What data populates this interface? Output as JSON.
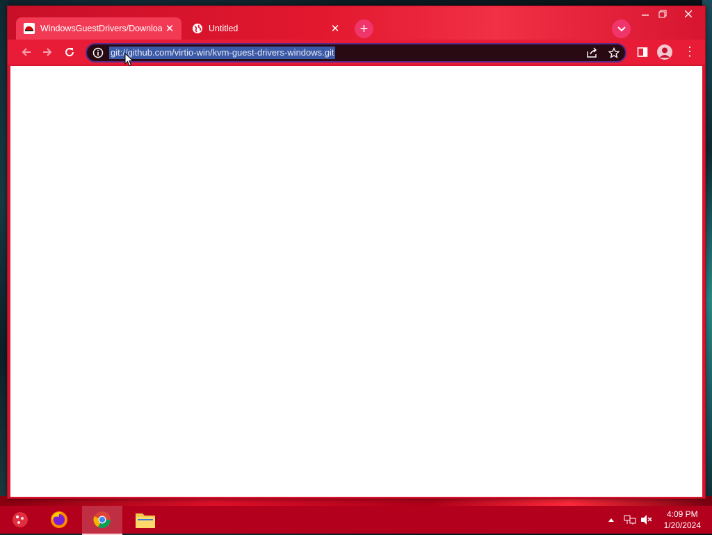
{
  "browser": {
    "tabs": [
      {
        "title": "WindowsGuestDrivers/Download",
        "active": true,
        "favicon": "redhat-icon"
      },
      {
        "title": "Untitled",
        "active": false,
        "favicon": "globe-icon"
      }
    ],
    "new_tab_label": "+",
    "address_bar": {
      "url": "git://github.com/virtio-win/kvm-guest-drivers-windows.git",
      "selected": true
    },
    "window_controls": [
      "minimize",
      "maximize",
      "close"
    ]
  },
  "taskbar": {
    "apps": [
      {
        "name": "start-menu",
        "icon": "start-icon"
      },
      {
        "name": "firefox",
        "icon": "firefox-icon"
      },
      {
        "name": "chrome",
        "icon": "chrome-icon",
        "active": true
      },
      {
        "name": "file-explorer",
        "icon": "folder-icon"
      }
    ],
    "clock": {
      "time": "4:09 PM",
      "date": "1/20/2024"
    }
  },
  "colors": {
    "theme_red": "#e81c36",
    "tab_active": "#f33a55",
    "taskbar": "#b3001c",
    "selection": "#3a5aa8"
  }
}
